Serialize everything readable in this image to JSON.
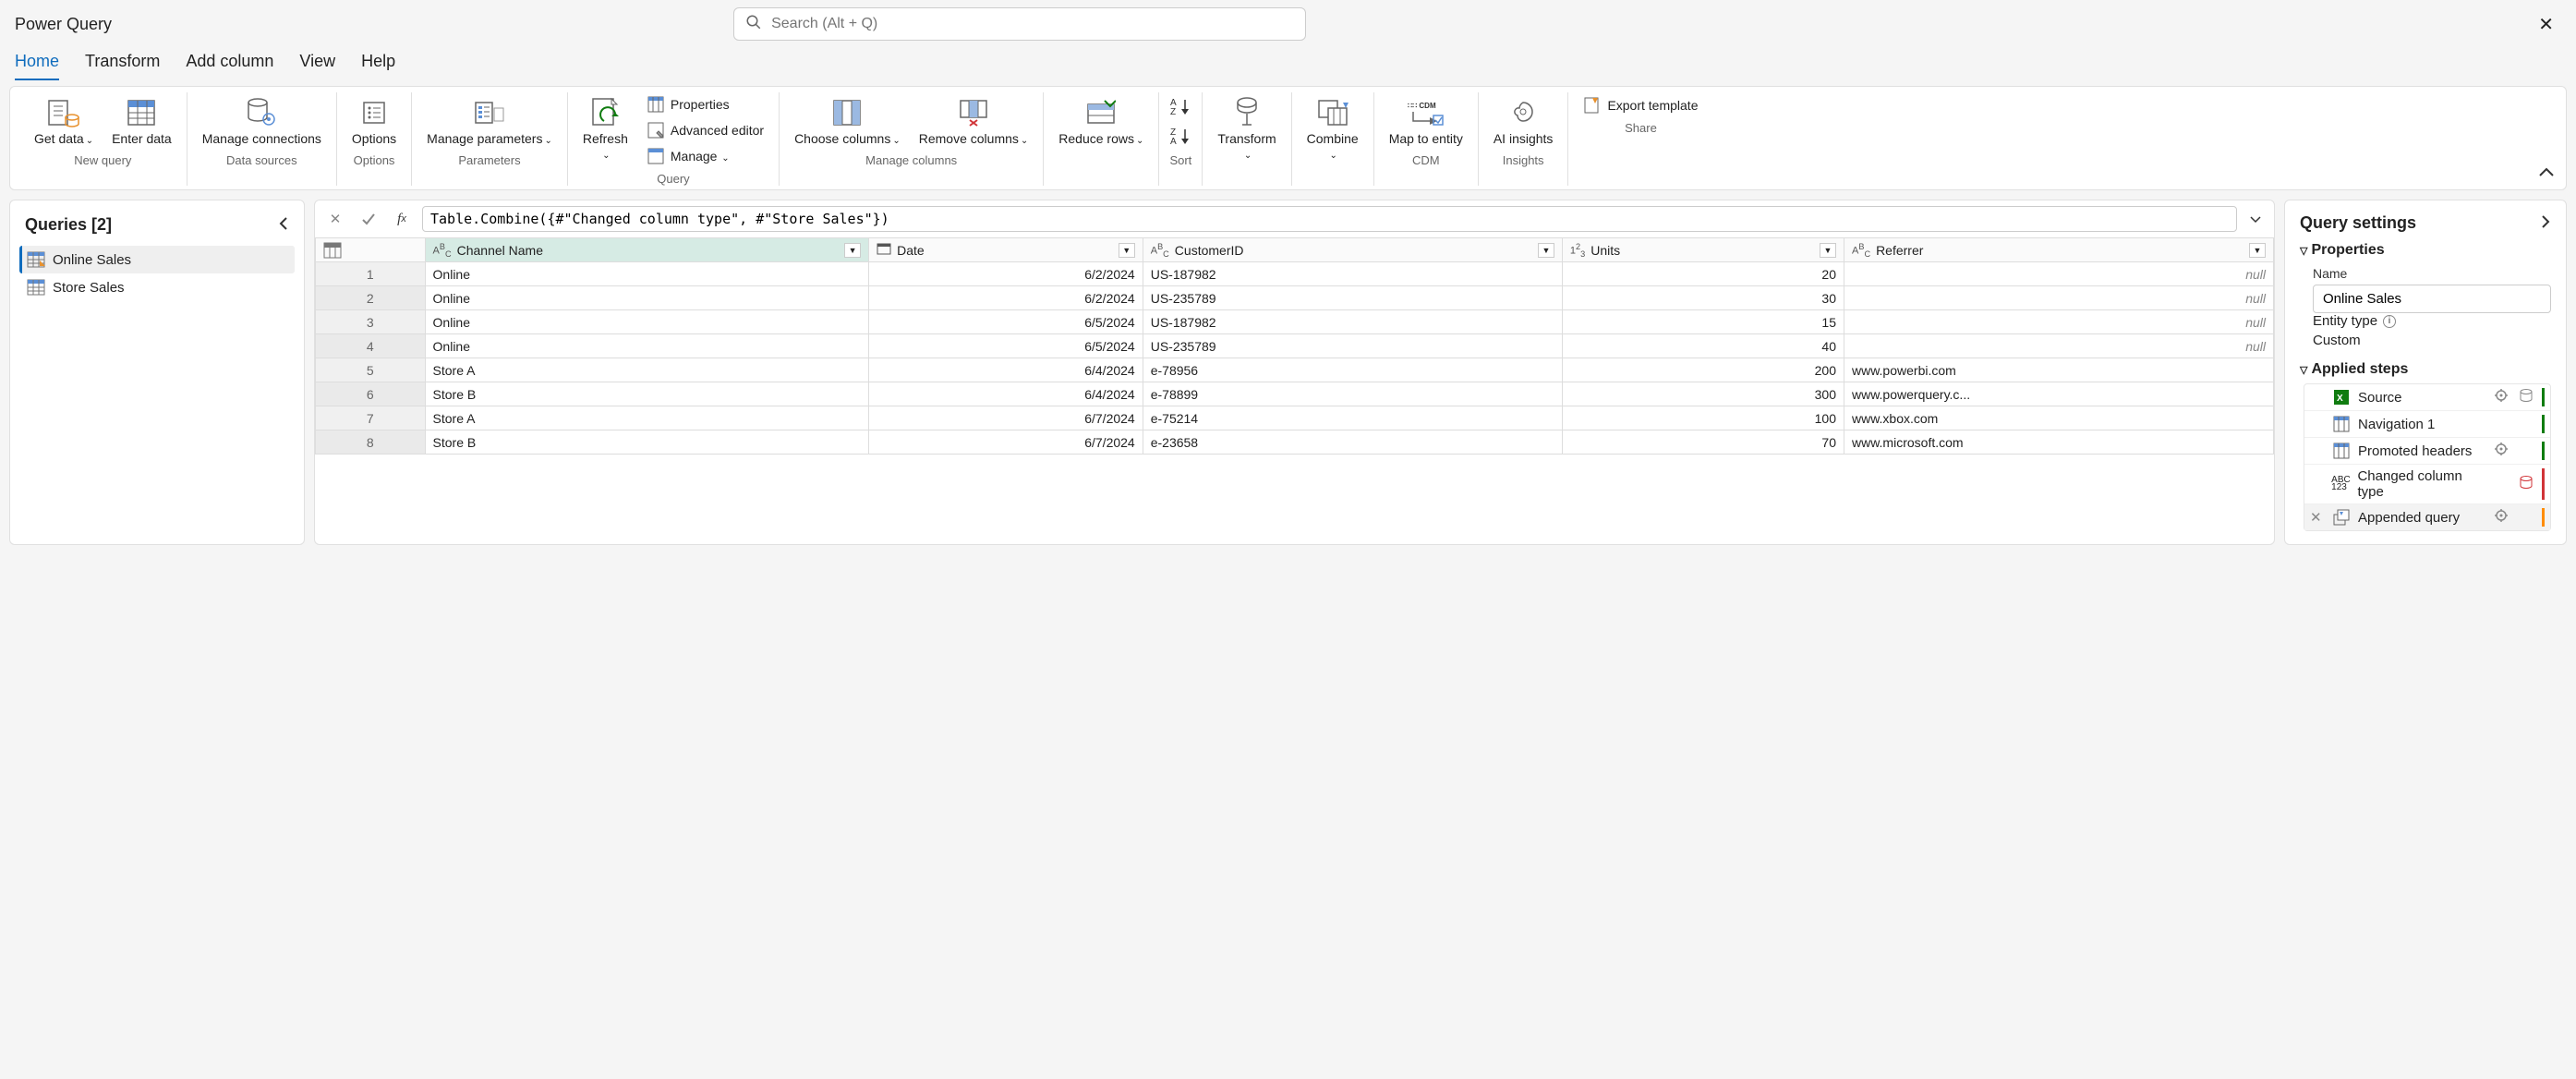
{
  "app": {
    "title": "Power Query"
  },
  "search": {
    "placeholder": "Search (Alt + Q)"
  },
  "tabs": {
    "home": "Home",
    "transform": "Transform",
    "add_column": "Add column",
    "view": "View",
    "help": "Help"
  },
  "ribbon": {
    "get_data": "Get data",
    "enter_data": "Enter data",
    "manage_connections": "Manage connections",
    "options": "Options",
    "manage_parameters": "Manage parameters",
    "refresh": "Refresh",
    "properties": "Properties",
    "advanced_editor": "Advanced editor",
    "manage": "Manage",
    "choose_columns": "Choose columns",
    "remove_columns": "Remove columns",
    "reduce_rows": "Reduce rows",
    "transform": "Transform",
    "combine": "Combine",
    "map_to_entity": "Map to entity",
    "ai_insights": "AI insights",
    "export_template": "Export template",
    "groups": {
      "new_query": "New query",
      "data_sources": "Data sources",
      "options": "Options",
      "parameters": "Parameters",
      "query": "Query",
      "manage_columns": "Manage columns",
      "sort": "Sort",
      "cdm": "CDM",
      "insights": "Insights",
      "share": "Share"
    }
  },
  "queries": {
    "header": "Queries [2]",
    "items": [
      {
        "label": "Online Sales",
        "selected": true
      },
      {
        "label": "Store Sales",
        "selected": false
      }
    ]
  },
  "formula": "Table.Combine({#\"Changed column type\", #\"Store Sales\"})",
  "columns": {
    "channel": "Channel Name",
    "date": "Date",
    "customer": "CustomerID",
    "units": "Units",
    "referrer": "Referrer"
  },
  "rows": [
    {
      "n": "1",
      "channel": "Online",
      "date": "6/2/2024",
      "customer": "US-187982",
      "units": "20",
      "referrer": "null"
    },
    {
      "n": "2",
      "channel": "Online",
      "date": "6/2/2024",
      "customer": "US-235789",
      "units": "30",
      "referrer": "null"
    },
    {
      "n": "3",
      "channel": "Online",
      "date": "6/5/2024",
      "customer": "US-187982",
      "units": "15",
      "referrer": "null"
    },
    {
      "n": "4",
      "channel": "Online",
      "date": "6/5/2024",
      "customer": "US-235789",
      "units": "40",
      "referrer": "null"
    },
    {
      "n": "5",
      "channel": "Store A",
      "date": "6/4/2024",
      "customer": "e-78956",
      "units": "200",
      "referrer": "www.powerbi.com"
    },
    {
      "n": "6",
      "channel": "Store B",
      "date": "6/4/2024",
      "customer": "e-78899",
      "units": "300",
      "referrer": "www.powerquery.c..."
    },
    {
      "n": "7",
      "channel": "Store A",
      "date": "6/7/2024",
      "customer": "e-75214",
      "units": "100",
      "referrer": "www.xbox.com"
    },
    {
      "n": "8",
      "channel": "Store B",
      "date": "6/7/2024",
      "customer": "e-23658",
      "units": "70",
      "referrer": "www.microsoft.com"
    }
  ],
  "settings": {
    "header": "Query settings",
    "properties_label": "Properties",
    "name_label": "Name",
    "name_value": "Online Sales",
    "entity_type_label": "Entity type",
    "entity_type_value": "Custom",
    "applied_steps_label": "Applied steps",
    "steps": [
      {
        "label": "Source"
      },
      {
        "label": "Navigation 1"
      },
      {
        "label": "Promoted headers"
      },
      {
        "label": "Changed column type"
      },
      {
        "label": "Appended query"
      }
    ]
  }
}
